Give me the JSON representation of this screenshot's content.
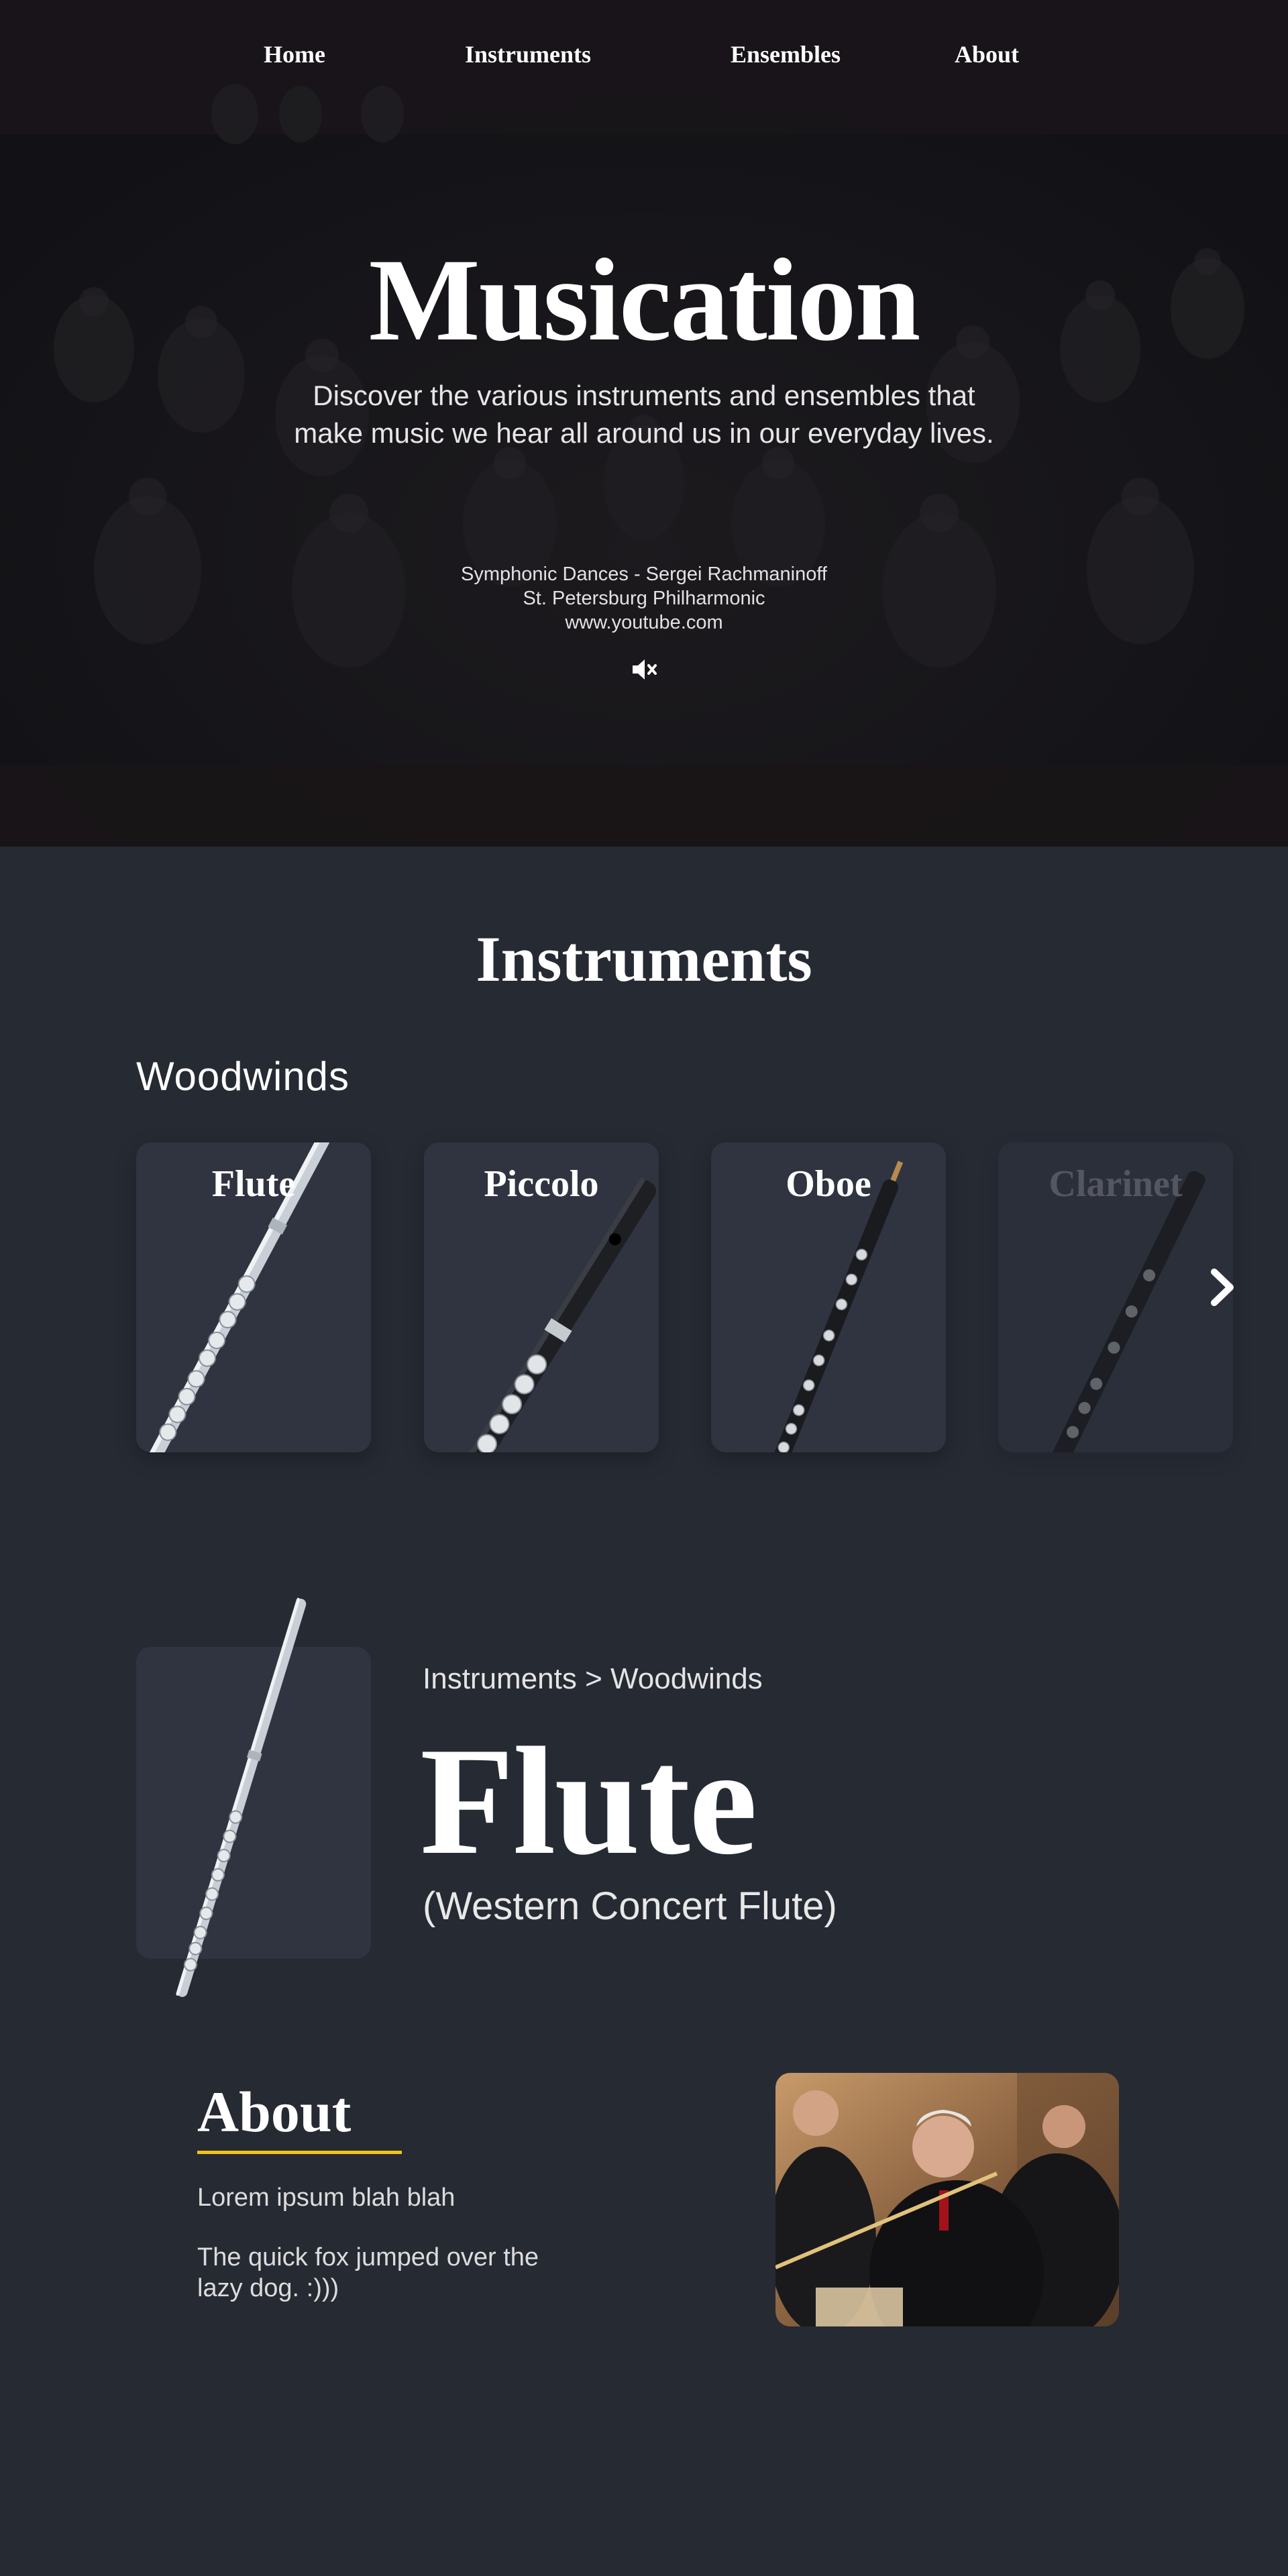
{
  "nav": {
    "items": [
      "Home",
      "Instruments",
      "Ensembles",
      "About"
    ]
  },
  "hero": {
    "title": "Musication",
    "subtitle_line1": "Discover the various instruments and ensembles that",
    "subtitle_line2": "make music we hear all around us in our everyday lives.",
    "credits": {
      "piece": "Symphonic Dances - Sergei Rachmaninoff",
      "performer": "St. Petersburg Philharmonic",
      "source": "www.youtube.com"
    },
    "mute_icon": "speaker-muted-icon"
  },
  "instruments": {
    "title": "Instruments",
    "category": "Woodwinds",
    "cards": [
      {
        "label": "Flute"
      },
      {
        "label": "Piccolo"
      },
      {
        "label": "Oboe"
      },
      {
        "label": "Clarinet"
      }
    ],
    "next_icon": "chevron-right-icon"
  },
  "detail": {
    "breadcrumb_root": "Instruments",
    "breadcrumb_sep": ">",
    "breadcrumb_leaf": "Woodwinds",
    "title": "Flute",
    "subtitle": "(Western Concert Flute)"
  },
  "about": {
    "title": "About",
    "p1": "Lorem ipsum blah blah",
    "p2": "The quick fox jumped over the lazy dog. :)))"
  },
  "colors": {
    "background": "#262a33",
    "card": "#2f3440",
    "accent": "#f2c21b"
  }
}
